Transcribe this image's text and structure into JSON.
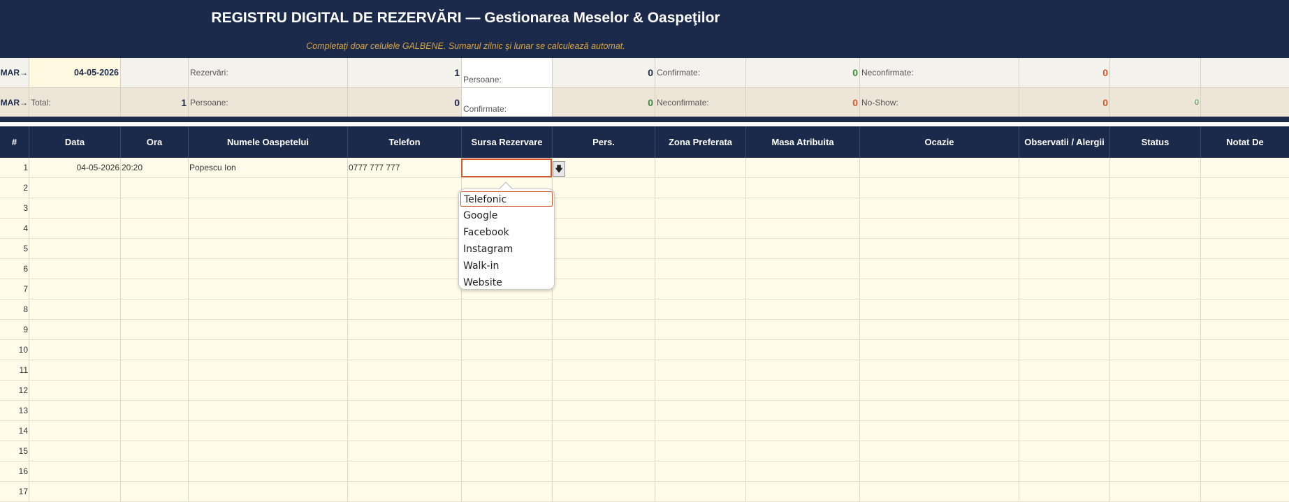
{
  "header": {
    "title": "REGISTRU DIGITAL DE REZERVĂRI  —  Gestionarea Meselor & Oaspeţilor",
    "subtitle": "Completaţi doar celulele GALBENE. Sumarul zilnic şi lunar se calculează automat."
  },
  "summary_daily": {
    "label": "SUMAR",
    "date": "04-05-2026",
    "rezervari_label": "Rezervări:",
    "rezervari_value": "1",
    "persoane_label": "Persoane:",
    "persoane_value": "0",
    "confirmate_label": "Confirmate:",
    "confirmate_value": "0",
    "neconfirmate_label": "Neconfirmate:",
    "neconfirmate_value": "0"
  },
  "summary_monthly": {
    "label": "SUMAR",
    "total_label": "Total:",
    "total_value": "1",
    "persoane_label": "Persoane:",
    "persoane_value": "0",
    "confirmate_label": "Confirmate:",
    "confirmate_value": "0",
    "neconfirmate_label": "Neconfirmate:",
    "neconfirmate_value": "0",
    "noshow_label": "No-Show:",
    "noshow_value": "0",
    "extra_value": "0"
  },
  "columns": [
    "#",
    "Data",
    "Ora",
    "Numele Oaspetelui",
    "Telefon",
    "Sursa Rezervare",
    "Pers.",
    "Zona Preferata",
    "Masa Atribuita",
    "Ocazie",
    "Observatii / Alergii",
    "Status",
    "Notat De"
  ],
  "rows": [
    {
      "num": "1",
      "data": "04-05-2026",
      "ora": "20:20",
      "nume": "Popescu Ion",
      "telefon": "0777 777 777"
    },
    {
      "num": "2"
    },
    {
      "num": "3"
    },
    {
      "num": "4"
    },
    {
      "num": "5"
    },
    {
      "num": "6"
    },
    {
      "num": "7"
    },
    {
      "num": "8"
    },
    {
      "num": "9"
    },
    {
      "num": "10"
    },
    {
      "num": "11"
    },
    {
      "num": "12"
    },
    {
      "num": "13"
    },
    {
      "num": "14"
    },
    {
      "num": "15"
    },
    {
      "num": "16"
    },
    {
      "num": "17"
    }
  ],
  "dropdown": {
    "icon": "download-arrow-icon",
    "options": [
      "Telefonic",
      "Google",
      "Facebook",
      "Instagram",
      "Walk-in",
      "Website"
    ],
    "highlighted": "Telefonic"
  },
  "colors": {
    "navy": "#1b2a4a",
    "gold": "#d9a441",
    "green": "#3c8a3a",
    "orange": "#d2592b",
    "cell_yellow": "#fffce9"
  }
}
